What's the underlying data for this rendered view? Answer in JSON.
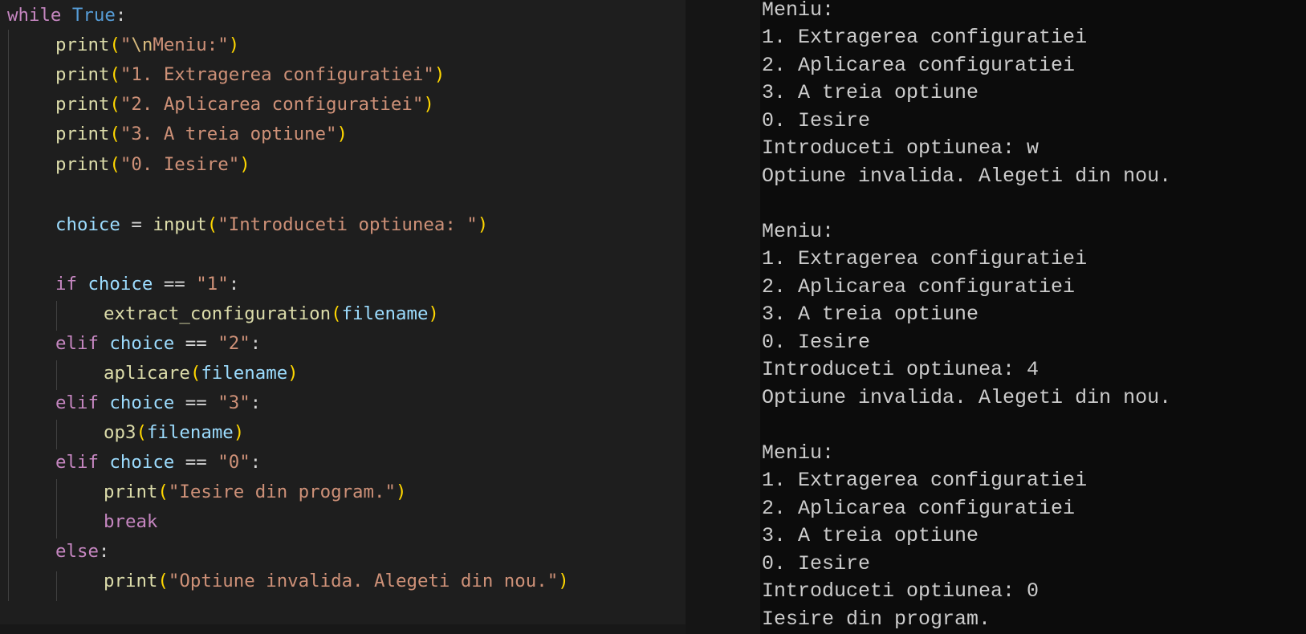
{
  "colors": {
    "editor_background": "#1e1e1e",
    "terminal_background": "#0c0c0c",
    "keyword": "#c586c0",
    "constant": "#569cd6",
    "function": "#dcdcaa",
    "variable": "#9cdcfe",
    "string": "#ce9178",
    "bracket": "#ffd700",
    "terminal_text": "#cccccc"
  },
  "editor": {
    "code": {
      "while_kw": "while",
      "true_kw": "True",
      "print_fn": "print",
      "menu_escape": "\\n",
      "menu_rest": "Meniu:",
      "opt1": "1. Extragerea configuratiei",
      "opt2": "2. Aplicarea configuratiei",
      "opt3": "3. A treia optiune",
      "opt0": "0. Iesire",
      "choice_var": "choice",
      "input_fn": "input",
      "prompt": "Introduceti optiunea: ",
      "if_kw": "if",
      "elif_kw": "elif",
      "else_kw": "else",
      "val1": "1",
      "val2": "2",
      "val3": "3",
      "val0": "0",
      "extract_fn": "extract_configuration",
      "aplicare_fn": "aplicare",
      "op3_fn": "op3",
      "filename_var": "filename",
      "exit_msg": "Iesire din program.",
      "break_kw": "break",
      "invalid_msg": "Optiune invalida. Alegeti din nou."
    }
  },
  "terminal": {
    "lines": [
      "Meniu:",
      "1. Extragerea configuratiei",
      "2. Aplicarea configuratiei",
      "3. A treia optiune",
      "0. Iesire",
      "Introduceti optiunea: w",
      "Optiune invalida. Alegeti din nou.",
      "",
      "Meniu:",
      "1. Extragerea configuratiei",
      "2. Aplicarea configuratiei",
      "3. A treia optiune",
      "0. Iesire",
      "Introduceti optiunea: 4",
      "Optiune invalida. Alegeti din nou.",
      "",
      "Meniu:",
      "1. Extragerea configuratiei",
      "2. Aplicarea configuratiei",
      "3. A treia optiune",
      "0. Iesire",
      "Introduceti optiunea: 0",
      "Iesire din program."
    ]
  }
}
